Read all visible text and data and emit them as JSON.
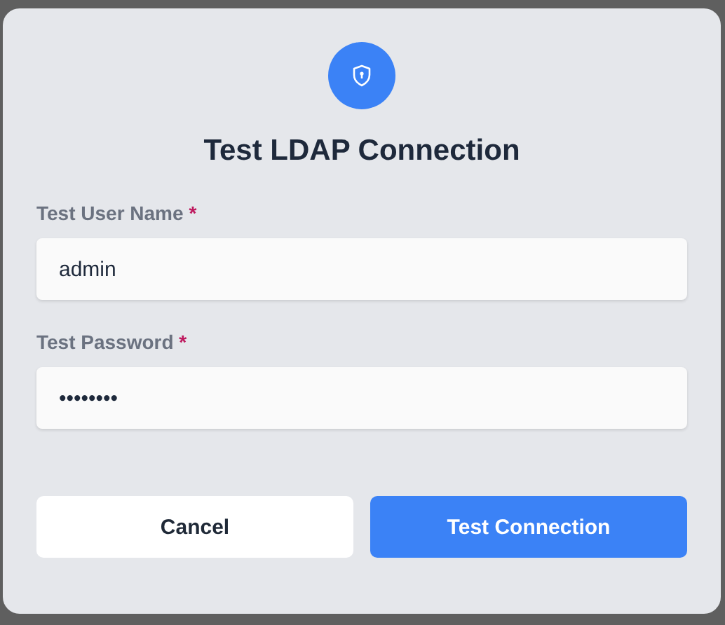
{
  "dialog": {
    "title": "Test LDAP Connection",
    "fields": [
      {
        "label": "Test User Name",
        "required_mark": "*",
        "value": "admin"
      },
      {
        "label": "Test Password",
        "required_mark": "*",
        "value": "••••••••"
      }
    ],
    "buttons": [
      {
        "label": "Cancel",
        "kind": "secondary"
      },
      {
        "label": "Test Connection",
        "kind": "primary"
      }
    ]
  }
}
